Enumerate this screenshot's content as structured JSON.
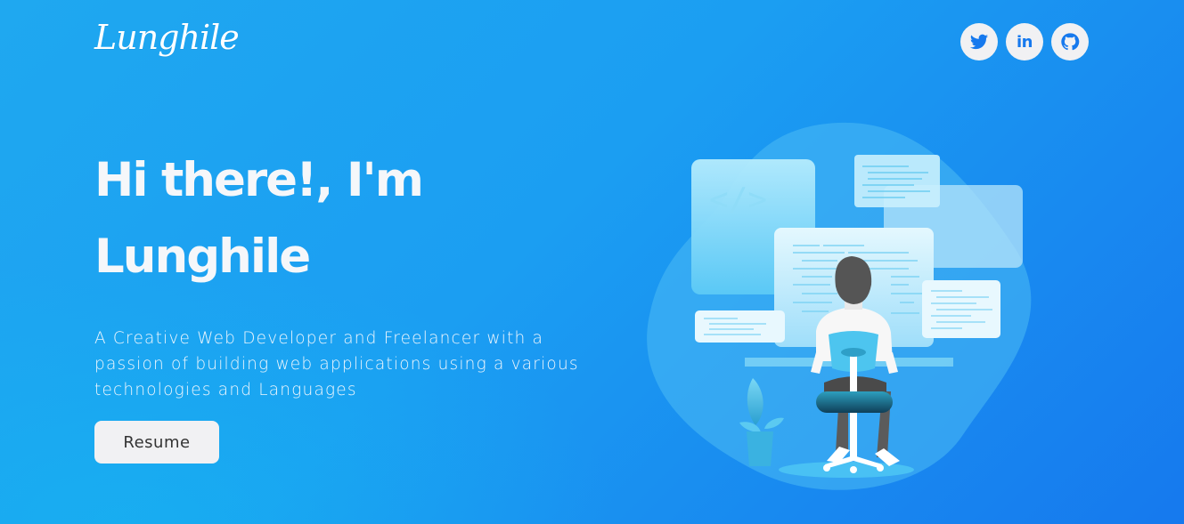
{
  "header": {
    "logo_text": "Lunghile",
    "socials": [
      {
        "name": "twitter",
        "icon": "twitter-icon"
      },
      {
        "name": "linkedin",
        "icon": "linkedin-icon",
        "glyph": "in"
      },
      {
        "name": "github",
        "icon": "github-icon"
      }
    ]
  },
  "hero": {
    "title_line1": "Hi there!, I'm",
    "title_line2": "Lunghile",
    "subtitle": "A Creative Web Developer and Freelancer with a passion of building web applications using a various technologies and Languages",
    "resume_label": "Resume"
  },
  "illustration": {
    "code_symbol": "</>"
  },
  "colors": {
    "accent": "#1679ee",
    "background_start": "#1fa8f0",
    "button_bg": "#f1f1f3"
  }
}
